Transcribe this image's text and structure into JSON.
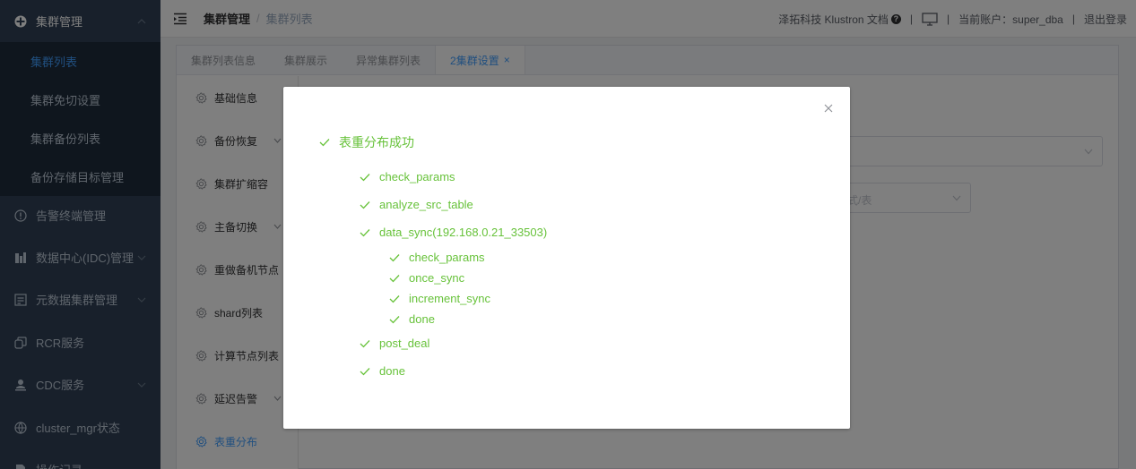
{
  "sidebar": {
    "items": [
      {
        "label": "集群管理",
        "icon": "cluster-icon"
      },
      {
        "label": "集群列表"
      },
      {
        "label": "集群免切设置"
      },
      {
        "label": "集群备份列表"
      },
      {
        "label": "备份存储目标管理"
      },
      {
        "label": "告警终端管理",
        "icon": "alert-circle-icon"
      },
      {
        "label": "数据中心(IDC)管理",
        "icon": "bar-chart-icon"
      },
      {
        "label": "元数据集群管理",
        "icon": "database-icon"
      },
      {
        "label": "RCR服务",
        "icon": "copy-icon"
      },
      {
        "label": "CDC服务",
        "icon": "user-icon"
      },
      {
        "label": "cluster_mgr状态",
        "icon": "globe-icon"
      },
      {
        "label": "操作记录",
        "icon": "document-icon"
      }
    ]
  },
  "header": {
    "breadcrumb": [
      "集群管理",
      "集群列表"
    ],
    "breadcrumb_sep": "/",
    "company_docs": "泽拓科技 Klustron 文档",
    "account_label": "当前账户：super_dba",
    "logout": "退出登录"
  },
  "tabs": [
    {
      "label": "集群列表信息"
    },
    {
      "label": "集群展示"
    },
    {
      "label": "异常集群列表"
    },
    {
      "label": "2集群设置",
      "close": "×"
    }
  ],
  "settings_menu": [
    {
      "label": "基础信息"
    },
    {
      "label": "备份恢复"
    },
    {
      "label": "集群扩缩容"
    },
    {
      "label": "主备切换"
    },
    {
      "label": "重做备机节点"
    },
    {
      "label": "shard列表"
    },
    {
      "label": "计算节点列表"
    },
    {
      "label": "延迟告警"
    },
    {
      "label": "表重分布"
    }
  ],
  "background_form": {
    "select_placeholder": "式/表"
  },
  "dialog": {
    "close": "×",
    "steps": [
      {
        "label": "表重分布成功",
        "level": 0
      },
      {
        "label": "check_params",
        "level": 1
      },
      {
        "label": "analyze_src_table",
        "level": 1
      },
      {
        "label": "data_sync(192.168.0.21_33503)",
        "level": 1
      },
      {
        "label": "check_params",
        "level": 2
      },
      {
        "label": "once_sync",
        "level": 2
      },
      {
        "label": "increment_sync",
        "level": 2
      },
      {
        "label": "done",
        "level": 2
      },
      {
        "label": "post_deal",
        "level": 1
      },
      {
        "label": "done",
        "level": 1
      }
    ]
  },
  "colors": {
    "sidebar_bg": "#304156",
    "submenu_bg": "#1f2d3d",
    "accent": "#409eff",
    "success": "#67c23a"
  }
}
